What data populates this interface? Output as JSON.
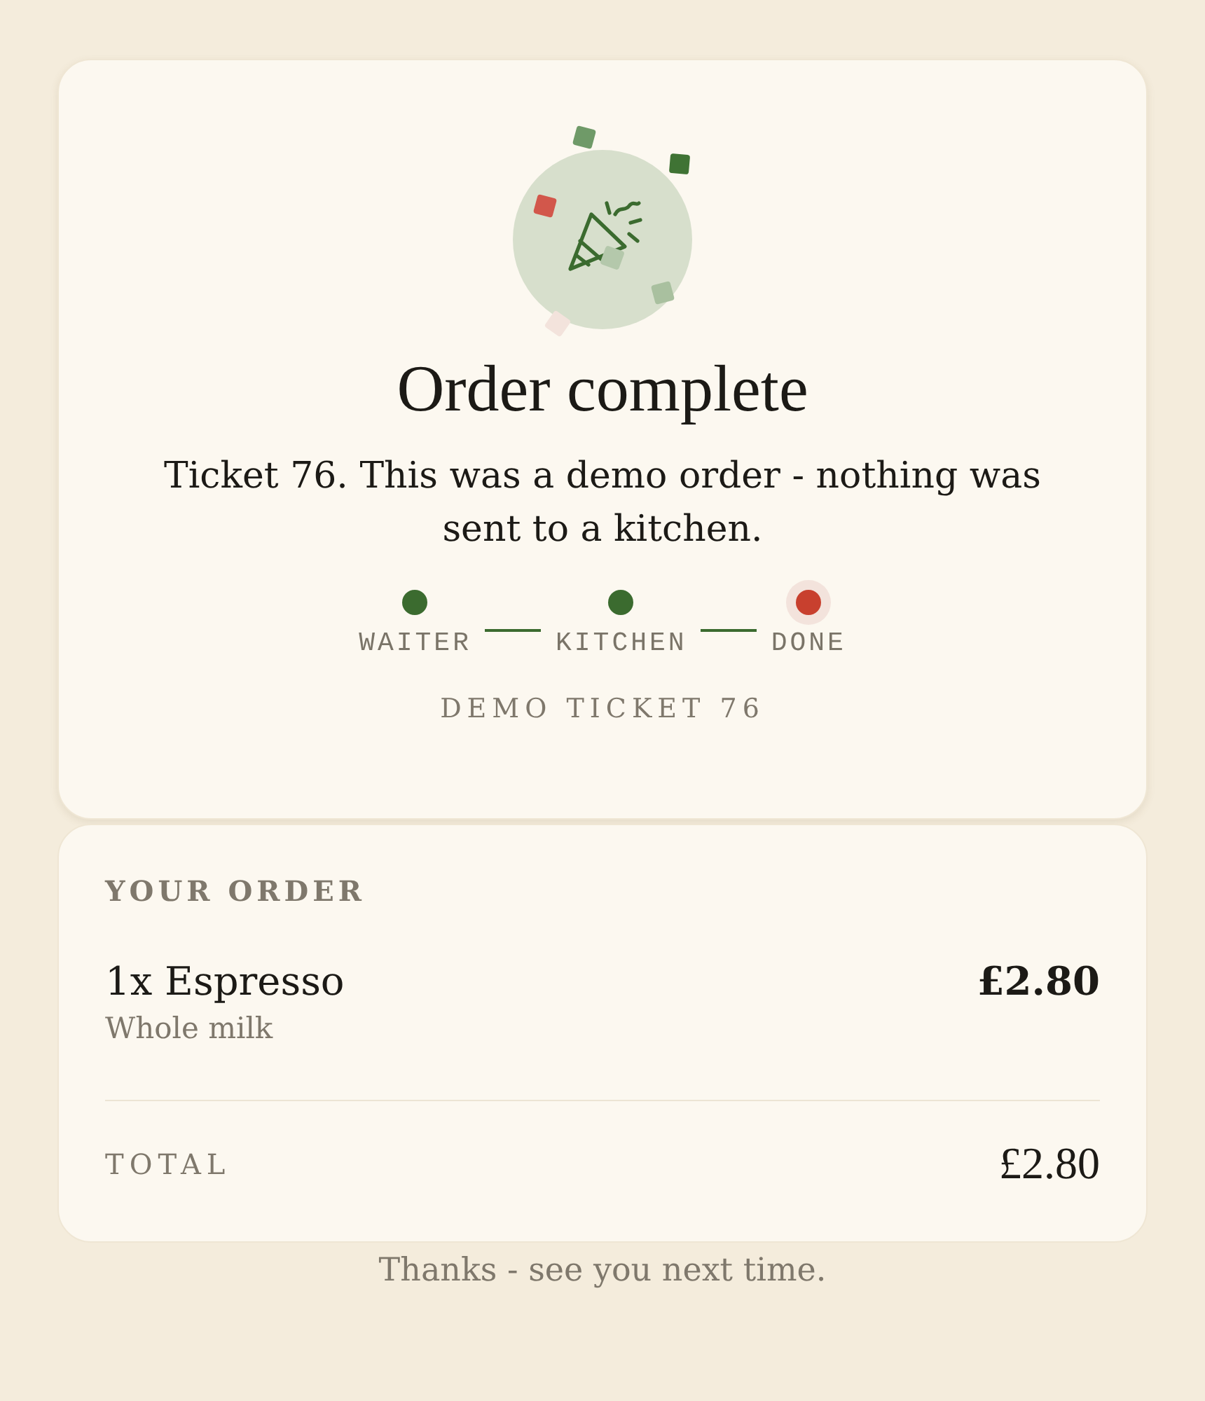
{
  "confirmation": {
    "title": "Order complete",
    "message": "Ticket 76. This was a demo order - nothing was sent to a kitchen.",
    "progress": [
      {
        "label": "WAITER",
        "complete": true,
        "selected": false
      },
      {
        "label": "KITCHEN",
        "complete": true,
        "selected": false
      },
      {
        "label": "DONE",
        "complete": false,
        "selected": true
      }
    ],
    "ticket_label": "DEMO TICKET 76"
  },
  "order": {
    "heading": "YOUR ORDER",
    "items": [
      {
        "name": "1x Espresso",
        "option": "Whole milk",
        "price": "£2.80"
      }
    ],
    "total_label": "TOTAL",
    "total": "£2.80"
  },
  "footer": "Thanks - see you next time."
}
